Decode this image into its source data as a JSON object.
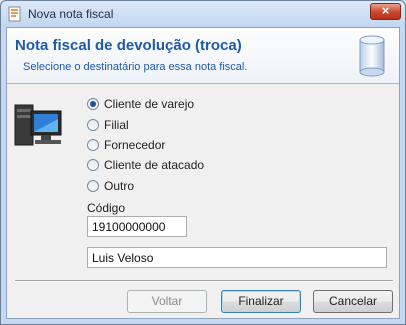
{
  "window": {
    "title": "Nova nota fiscal",
    "close_glyph": "×"
  },
  "header": {
    "title": "Nota fiscal de devolução (troca)",
    "subtitle": "Selecione o destinatário para essa nota fiscal.",
    "icon": "database-cylinder-icon"
  },
  "recipient_icon": "computer-icon",
  "recipient_options": [
    {
      "label": "Cliente de varejo",
      "selected": true
    },
    {
      "label": "Filial",
      "selected": false
    },
    {
      "label": "Fornecedor",
      "selected": false
    },
    {
      "label": "Cliente de atacado",
      "selected": false
    },
    {
      "label": "Outro",
      "selected": false
    }
  ],
  "codigo": {
    "label": "Código",
    "value": "19100000000"
  },
  "name_field": {
    "value": "Luis Veloso"
  },
  "buttons": {
    "back": {
      "label": "Voltar",
      "enabled": false
    },
    "finish": {
      "label": "Finalizar",
      "enabled": true,
      "default": true
    },
    "cancel": {
      "label": "Cancelar",
      "enabled": true
    }
  },
  "colors": {
    "accent": "#1e5aa8",
    "selected_radio": "#1d4f9c"
  }
}
